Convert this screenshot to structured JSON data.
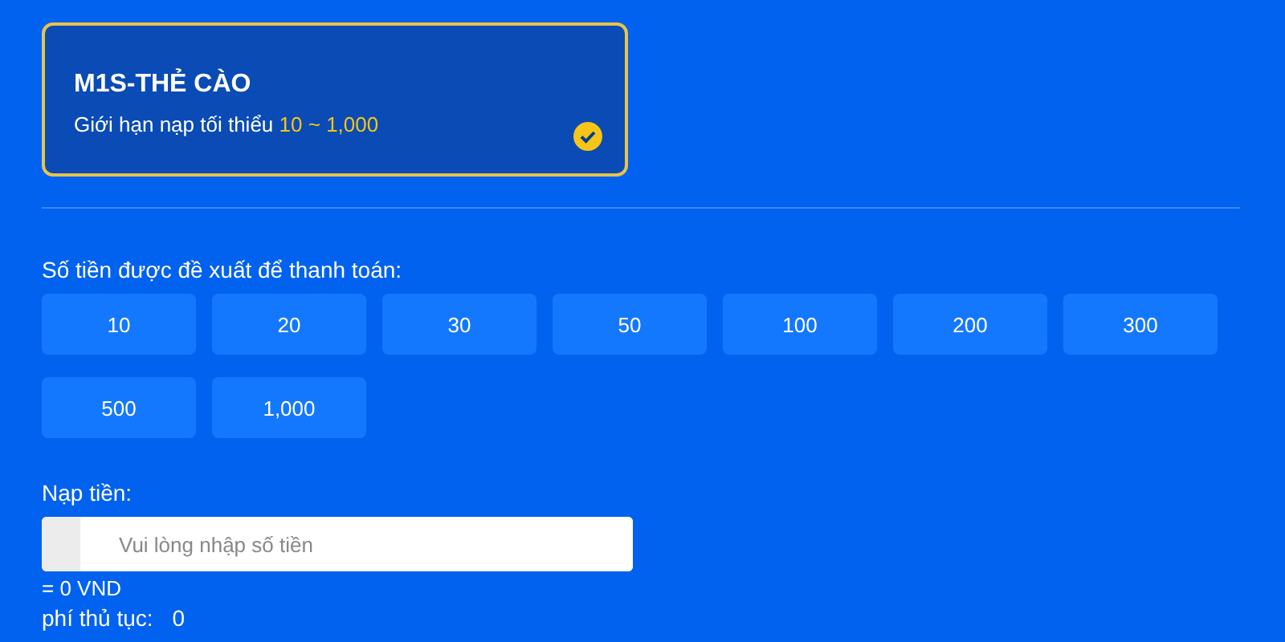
{
  "method": {
    "title": "M1S-THẺ CÀO",
    "limit_label": "Giới hạn nạp tối thiểu",
    "limit_range": "10 ~ 1,000",
    "selected": true
  },
  "suggested": {
    "label": "Số tiền được đề xuất để thanh toán:",
    "amounts": [
      "10",
      "20",
      "30",
      "50",
      "100",
      "200",
      "300",
      "500",
      "1,000"
    ]
  },
  "deposit": {
    "label": "Nạp tiền:",
    "placeholder": "Vui lòng nhập số tiền",
    "converted": "= 0 VND",
    "fee_label": "phí thủ tục:",
    "fee_value": "0"
  }
}
